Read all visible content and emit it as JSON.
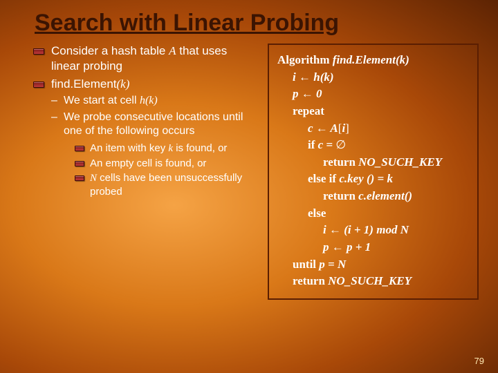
{
  "title": "Search with Linear Probing",
  "slide_number": "79",
  "left": {
    "p1a": "Consider a hash table ",
    "p1_it": "A",
    "p1b": " that uses linear probing",
    "p2a": "find.Element",
    "p2b": "(k)",
    "s1a": "We start at cell ",
    "s1b": "h(k)",
    "s2": "We probe consecutive locations until one of the following occurs",
    "t1a": "An item with key ",
    "t1_it": "k",
    "t1b": " is found, or",
    "t2": "An empty cell is found, or",
    "t3a_it": "N",
    "t3b": " cells have been unsuccessfully probed"
  },
  "algo": {
    "kw_algorithm": "Algorithm",
    "name": " find.Element(k)",
    "l1_lhs": "i ",
    "arrow": "←",
    "l1_rhs": " h(k)",
    "l2_lhs": "p ",
    "l2_rhs": " 0",
    "kw_repeat": "repeat",
    "l3_lhs": "c ",
    "l3_rhs_a": " A",
    "l3_rhs_b": "[",
    "l3_rhs_c": "i",
    "l3_rhs_d": "]",
    "kw_if": "if ",
    "l4_rhs": "c = ",
    "empty": "∅",
    "kw_return": "return ",
    "no_key": "NO_SUCH_KEY",
    "kw_elseif": "else if ",
    "l6_rhs": "c.key () = k",
    "l7_rhs": "c.element()",
    "kw_else": "else",
    "l8_lhs": "i ",
    "l8_rhs": " (i + 1) mod N",
    "l9_lhs": "p ",
    "l9_rhs": " p + 1",
    "kw_until": "until  ",
    "l10_rhs": "p = N"
  }
}
